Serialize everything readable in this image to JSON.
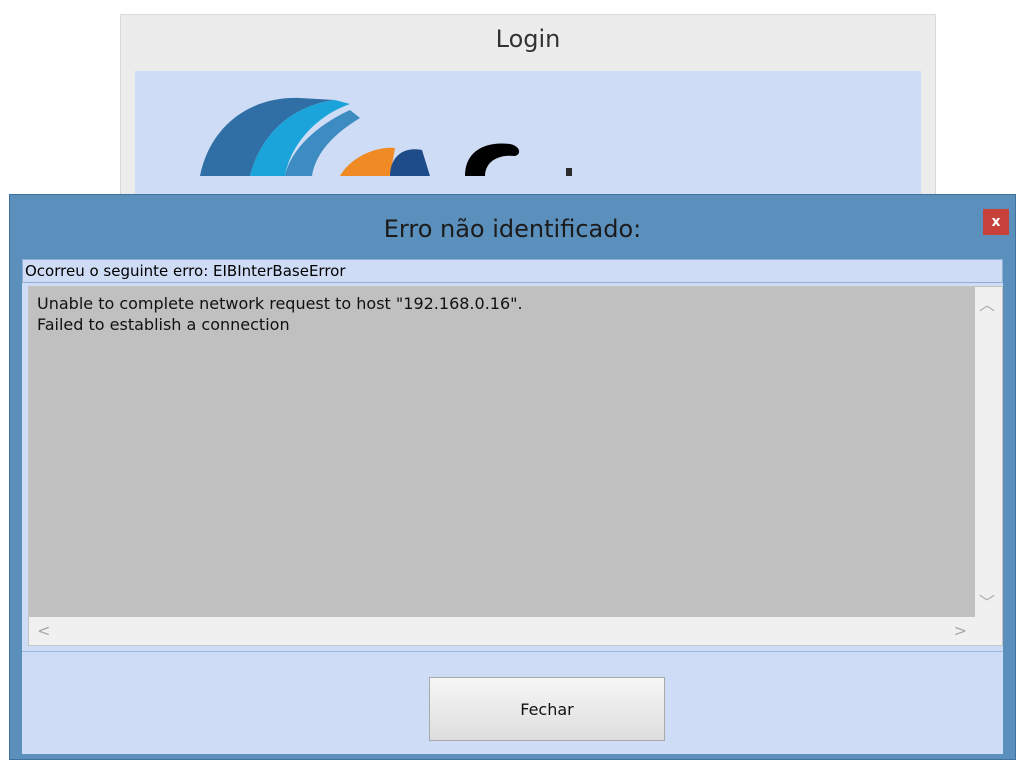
{
  "login_window": {
    "title": "Login"
  },
  "dialog": {
    "title": "Erro não identificado:",
    "close_label": "x",
    "error_label": "Ocorreu o seguinte erro: EIBInterBaseError",
    "message_lines": [
      "Unable to complete network request to host \"192.168.0.16\".",
      "Failed to establish a connection"
    ],
    "close_button_label": "Fechar",
    "icons": {
      "scroll_up": "chevron-up-icon",
      "scroll_down": "chevron-down-icon",
      "scroll_left": "chevron-left-icon",
      "scroll_right": "chevron-right-icon"
    },
    "colors": {
      "title_bar": "#5b8fbc",
      "client": "#cfdcf5",
      "close_button": "#c7403a",
      "memo_text_bg": "#c0c0c0"
    }
  }
}
